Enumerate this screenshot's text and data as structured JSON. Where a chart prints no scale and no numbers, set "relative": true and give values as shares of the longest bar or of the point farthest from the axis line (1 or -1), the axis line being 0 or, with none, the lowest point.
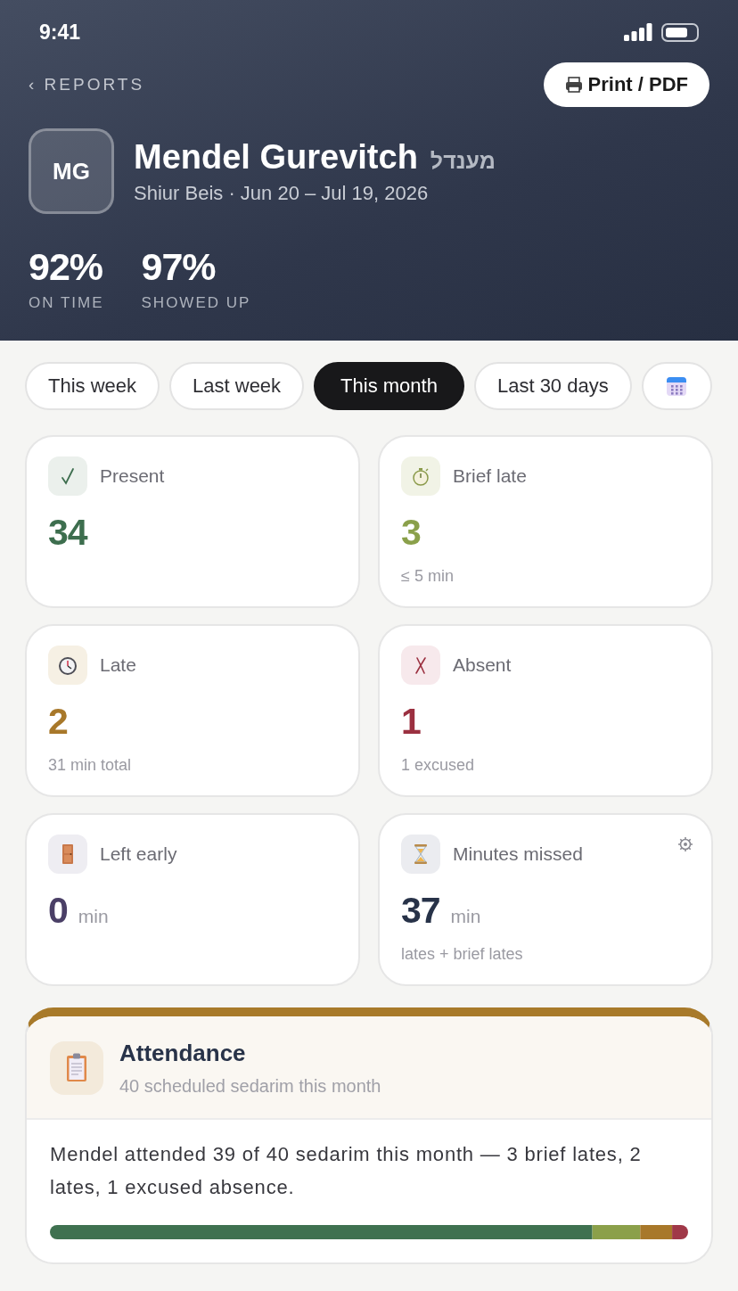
{
  "status_bar": {
    "time": "9:41"
  },
  "nav": {
    "back_link": "‹ REPORTS",
    "print_button": "Print / PDF"
  },
  "profile": {
    "initials": "MG",
    "name": "Mendel Gurevitch",
    "hebrew_name": "מענדל",
    "subtitle": "Shiur Beis · Jun 20 – Jul 19, 2026"
  },
  "summary_stats": [
    {
      "value": "92%",
      "label": "ON TIME"
    },
    {
      "value": "97%",
      "label": "SHOWED UP"
    }
  ],
  "range_filters": [
    {
      "kind": "text",
      "label": "This week",
      "selected": false
    },
    {
      "kind": "text",
      "label": "Last week",
      "selected": false
    },
    {
      "kind": "text",
      "label": "This month",
      "selected": true
    },
    {
      "kind": "text",
      "label": "Last 30 days",
      "selected": false
    },
    {
      "kind": "calendar",
      "selected": false
    }
  ],
  "stat_cards": [
    {
      "kind": "present",
      "label": "Present",
      "value": "34",
      "color": "#3d6e4e",
      "settings": false
    },
    {
      "kind": "brief_late",
      "label": "Brief late",
      "value": "3",
      "note": "≤ 5 min",
      "color": "#8aa04a",
      "settings": false
    },
    {
      "kind": "late",
      "label": "Late",
      "value": "2",
      "note": "31 min total",
      "color": "#a8782a",
      "settings": false
    },
    {
      "kind": "absent",
      "label": "Absent",
      "value": "1",
      "note": "1 excused",
      "color": "#9b3040",
      "settings": false
    },
    {
      "kind": "left_early",
      "label": "Left early",
      "value": "0",
      "unit": "min",
      "color": "#4a3f66",
      "settings": false
    },
    {
      "kind": "minutes_missed",
      "label": "Minutes missed",
      "value": "37",
      "unit": "min",
      "note": "lates + brief lates",
      "color": "#273248",
      "settings": true
    }
  ],
  "attendance": {
    "title": "Attendance",
    "subtitle": "40 scheduled sedarim this month",
    "summary": "Mendel attended 39 of 40 sedarim this month — 3 brief lates, 2 lates, 1 excused absence.",
    "chart_data": {
      "type": "bar",
      "orientation": "horizontal",
      "stacked": true,
      "relative": true,
      "series": [
        {
          "color": "#3f7150",
          "values": [
            0.85
          ]
        },
        {
          "color": "#8ba04a",
          "values": [
            0.075
          ]
        },
        {
          "color": "#a8782a",
          "values": [
            0.05
          ]
        },
        {
          "color": "#a03848",
          "values": [
            0.025
          ]
        }
      ]
    }
  }
}
